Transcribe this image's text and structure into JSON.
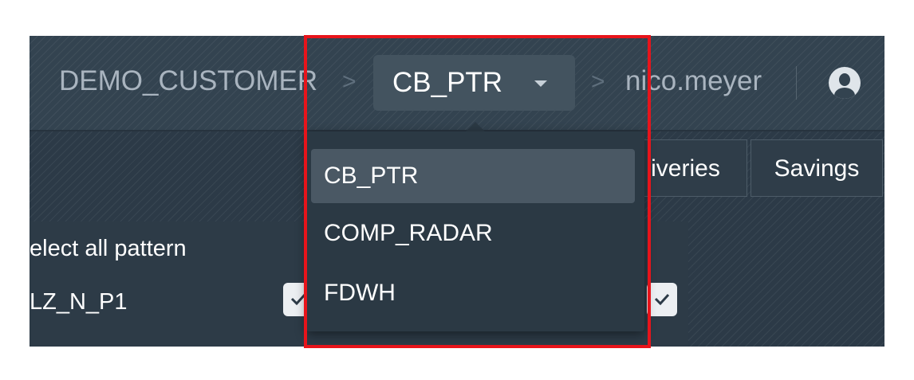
{
  "breadcrumb": {
    "customer": "DEMO_CUSTOMER",
    "separator": ">",
    "project": "CB_PTR",
    "user": "nico.meyer"
  },
  "tabs": [
    {
      "label": "iveries"
    },
    {
      "label": "Savings"
    }
  ],
  "panel": {
    "title": "elect all pattern",
    "row_label": "LZ_N_P1"
  },
  "dropdown": {
    "items": [
      {
        "label": "CB_PTR",
        "selected": true
      },
      {
        "label": "COMP_RADAR",
        "selected": false
      },
      {
        "label": "FDWH",
        "selected": false
      }
    ]
  },
  "colors": {
    "background": "#2c3a47",
    "dropdown_bg": "#2b3944",
    "selected_item_bg": "#4a5864",
    "highlight_border": "#e8141b"
  },
  "icons": {
    "dropdown_caret": "chevron-down-icon",
    "user": "user-circle-icon",
    "checkbox": "checkmark-icon"
  }
}
